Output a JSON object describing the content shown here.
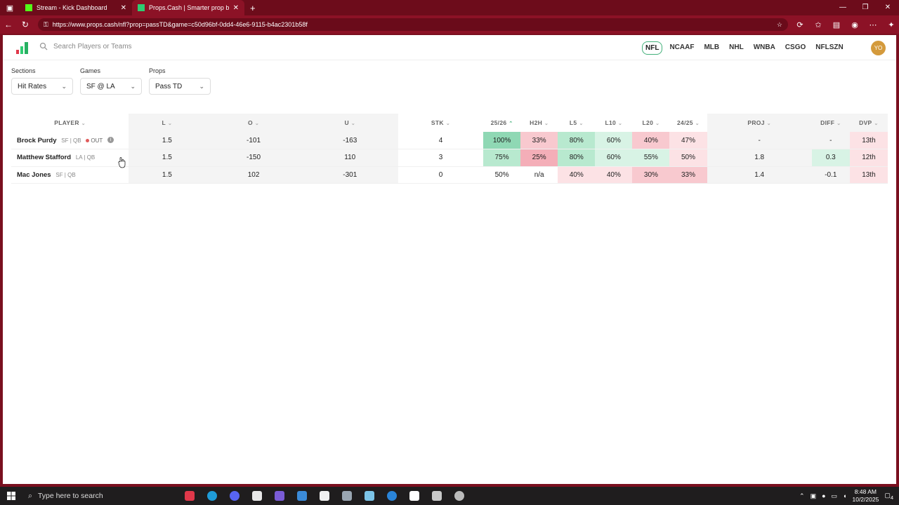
{
  "browser": {
    "tabs": [
      {
        "title": "Stream - Kick Dashboard",
        "favicon_color": "#53fc18"
      },
      {
        "title": "Props.Cash | Smarter prop bets. M",
        "favicon_color": "#2ecc71"
      }
    ],
    "url": "https://www.props.cash/nfl?prop=passTD&game=c50d96bf-0dd4-46e6-9115-b4ac2301b58f"
  },
  "header": {
    "search_placeholder": "Search Players or Teams",
    "leagues": [
      "NFL",
      "NCAAF",
      "MLB",
      "NHL",
      "WNBA",
      "CSGO",
      "NFLSZN"
    ],
    "active_league": "NFL",
    "avatar_initials": "YO"
  },
  "filters": {
    "sections": {
      "label": "Sections",
      "value": "Hit Rates"
    },
    "games": {
      "label": "Games",
      "value": "SF @ LA"
    },
    "props": {
      "label": "Props",
      "value": "Pass TD"
    }
  },
  "table": {
    "columns": [
      "PLAYER",
      "L",
      "O",
      "U",
      "STK",
      "25/26",
      "H2H",
      "L5",
      "L10",
      "L20",
      "24/25",
      "PROJ",
      "DIFF",
      "DVP"
    ],
    "rows": [
      {
        "name": "Brock Purdy",
        "meta": "SF | QB",
        "status": "OUT",
        "l": "1.5",
        "o": "-101",
        "u": "-163",
        "stk": "4",
        "s2526": "100%",
        "h2h": "33%",
        "l5": "80%",
        "l10": "60%",
        "l20": "40%",
        "s2425": "47%",
        "proj": "-",
        "diff": "-",
        "dvp": "13th"
      },
      {
        "name": "Matthew Stafford",
        "meta": "LA | QB",
        "status": "",
        "l": "1.5",
        "o": "-150",
        "u": "110",
        "stk": "3",
        "s2526": "75%",
        "h2h": "25%",
        "l5": "80%",
        "l10": "60%",
        "l20": "55%",
        "s2425": "50%",
        "proj": "1.8",
        "diff": "0.3",
        "dvp": "12th"
      },
      {
        "name": "Mac Jones",
        "meta": "SF | QB",
        "status": "",
        "l": "1.5",
        "o": "102",
        "u": "-301",
        "stk": "0",
        "s2526": "50%",
        "h2h": "n/a",
        "l5": "40%",
        "l10": "40%",
        "l20": "30%",
        "s2425": "33%",
        "proj": "1.4",
        "diff": "-0.1",
        "dvp": "13th"
      }
    ]
  },
  "taskbar": {
    "search_placeholder": "Type here to search",
    "time": "8:48 AM",
    "date": "10/2/2025",
    "notification_count": "4"
  }
}
